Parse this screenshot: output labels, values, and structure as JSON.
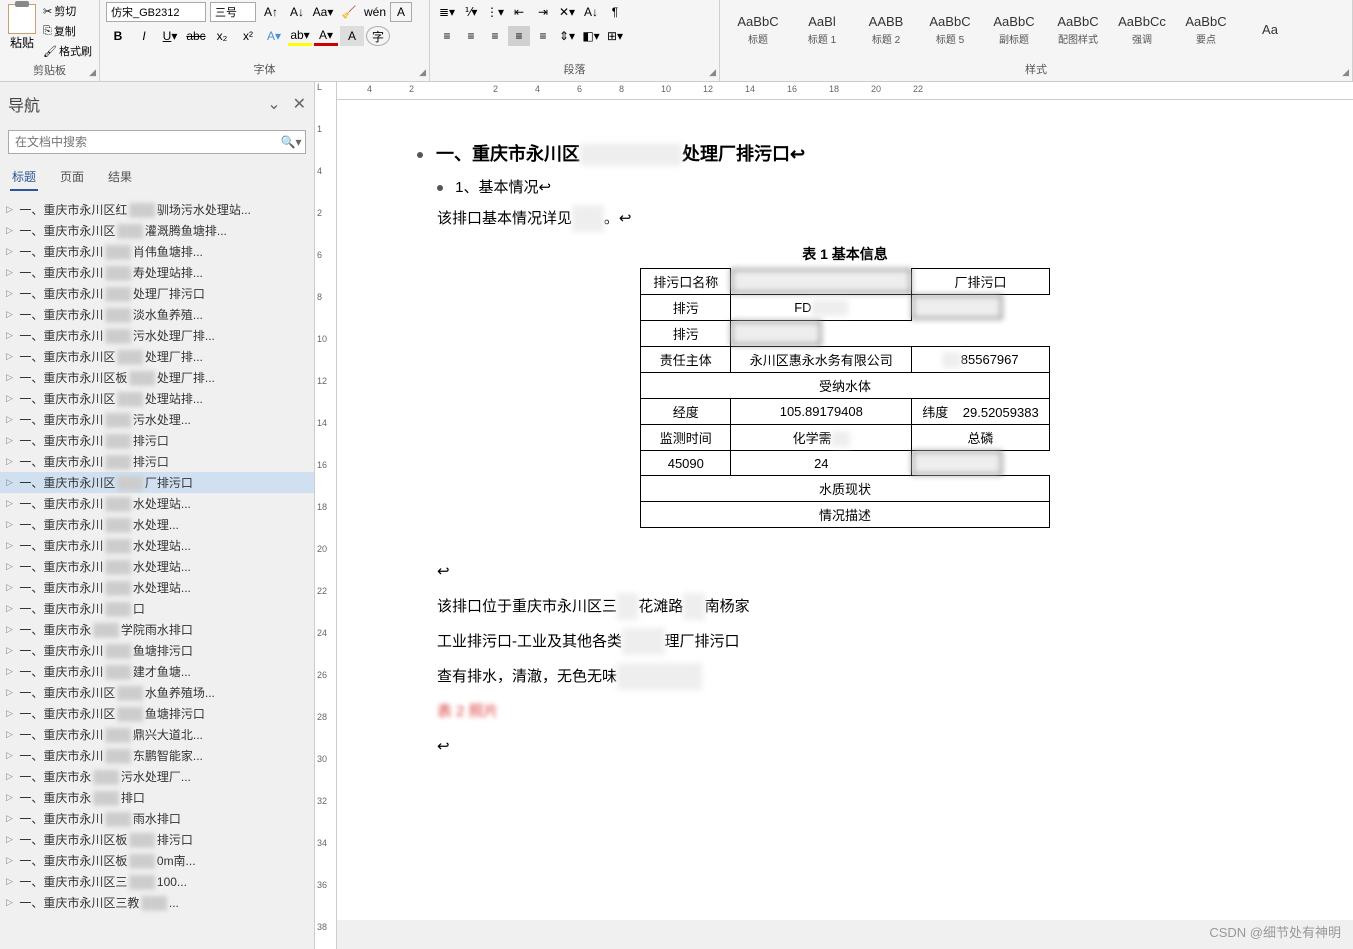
{
  "ribbon": {
    "clipboard": {
      "paste": "粘贴",
      "cut": "剪切",
      "copy": "复制",
      "format_painter": "格式刷",
      "label": "剪贴板"
    },
    "font": {
      "name": "仿宋_GB2312",
      "size": "三号",
      "label": "字体"
    },
    "paragraph": {
      "label": "段落"
    },
    "styles": {
      "label": "样式",
      "items": [
        {
          "preview": "AaBbC",
          "label": "标题"
        },
        {
          "preview": "AaBl",
          "label": "标题 1"
        },
        {
          "preview": "AABB",
          "label": "标题 2"
        },
        {
          "preview": "AaBbC",
          "label": "标题 5"
        },
        {
          "preview": "AaBbC",
          "label": "副标题"
        },
        {
          "preview": "AaBbC",
          "label": "配图样式"
        },
        {
          "preview": "AaBbCc",
          "label": "强调"
        },
        {
          "preview": "AaBbC",
          "label": "要点"
        },
        {
          "preview": "Aa",
          "label": ""
        }
      ]
    }
  },
  "nav": {
    "title": "导航",
    "search_placeholder": "在文档中搜索",
    "tabs": [
      "标题",
      "页面",
      "结果"
    ],
    "items": [
      {
        "pre": "一、",
        "city": "重庆市永川区红",
        "suf": "驯场污水处理站..."
      },
      {
        "pre": "一、",
        "city": "重庆市永川区",
        "suf": "灌溉腾鱼塘排..."
      },
      {
        "pre": "一、",
        "city": "重庆市永川",
        "suf": "肖伟鱼塘排..."
      },
      {
        "pre": "一、",
        "city": "重庆市永川",
        "suf": "寿处理站排..."
      },
      {
        "pre": "一、",
        "city": "重庆市永川",
        "suf": "处理厂排污口"
      },
      {
        "pre": "一、",
        "city": "重庆市永川",
        "suf": "淡水鱼养殖..."
      },
      {
        "pre": "一、",
        "city": "重庆市永川",
        "suf": "污水处理厂排..."
      },
      {
        "pre": "一、",
        "city": "重庆市永川区",
        "suf": "处理厂排..."
      },
      {
        "pre": "一、",
        "city": "重庆市永川区板",
        "suf": "处理厂排..."
      },
      {
        "pre": "一、",
        "city": "重庆市永川区",
        "suf": "处理站排..."
      },
      {
        "pre": "一、",
        "city": "重庆市永川",
        "suf": "污水处理..."
      },
      {
        "pre": "一、",
        "city": "重庆市永川",
        "suf": "排污口"
      },
      {
        "pre": "一、",
        "city": "重庆市永川",
        "suf": "排污口"
      },
      {
        "pre": "一、",
        "city": "重庆市永川区",
        "suf": "厂排污口",
        "selected": true
      },
      {
        "pre": "一、",
        "city": "重庆市永川",
        "suf": "水处理站..."
      },
      {
        "pre": "一、",
        "city": "重庆市永川",
        "suf": "水处理..."
      },
      {
        "pre": "一、",
        "city": "重庆市永川",
        "suf": "水处理站..."
      },
      {
        "pre": "一、",
        "city": "重庆市永川",
        "suf": "水处理站..."
      },
      {
        "pre": "一、",
        "city": "重庆市永川",
        "suf": "水处理站..."
      },
      {
        "pre": "一、",
        "city": "重庆市永川",
        "suf": "口"
      },
      {
        "pre": "一、",
        "city": "重庆市永",
        "suf": "学院雨水排口"
      },
      {
        "pre": "一、",
        "city": "重庆市永川",
        "suf": "鱼塘排污口"
      },
      {
        "pre": "一、",
        "city": "重庆市永川",
        "suf": "建才鱼塘..."
      },
      {
        "pre": "一、",
        "city": "重庆市永川区",
        "suf": "水鱼养殖场..."
      },
      {
        "pre": "一、",
        "city": "重庆市永川区",
        "suf": "鱼塘排污口"
      },
      {
        "pre": "一、",
        "city": "重庆市永川",
        "suf": "鼎兴大道北..."
      },
      {
        "pre": "一、",
        "city": "重庆市永川",
        "suf": "东鹏智能家..."
      },
      {
        "pre": "一、",
        "city": "重庆市永",
        "suf": "污水处理厂..."
      },
      {
        "pre": "一、",
        "city": "重庆市永",
        "suf": "排口"
      },
      {
        "pre": "一、",
        "city": "重庆市永川",
        "suf": "雨水排口"
      },
      {
        "pre": "一、",
        "city": "重庆市永川区板",
        "suf": "排污口"
      },
      {
        "pre": "一、",
        "city": "重庆市永川区板",
        "suf": "0m南..."
      },
      {
        "pre": "一、",
        "city": "重庆市永川区三",
        "suf": "100..."
      },
      {
        "pre": "一、",
        "city": "重庆市永川区三教",
        "suf": "..."
      }
    ]
  },
  "vruler": [
    "L",
    "",
    "1",
    "",
    "4",
    "",
    "2",
    "",
    "6",
    "",
    "8",
    "",
    "10",
    "",
    "12",
    "",
    "14",
    "",
    "16",
    "",
    "18",
    "",
    "20",
    "",
    "22",
    "",
    "24",
    "",
    "26",
    "",
    "28",
    "",
    "30",
    "",
    "32",
    "",
    "34",
    "",
    "36",
    "",
    "38"
  ],
  "hruler": [
    "4",
    "2",
    "",
    "2",
    "4",
    "6",
    "8",
    "10",
    "12",
    "14",
    "16",
    "18",
    "20",
    "22"
  ],
  "doc": {
    "h1_pre": "一、重庆市永川区",
    "h1_suf": "处理厂排污口",
    "h2": "1、基本情况",
    "p1_pre": "该排口基本情况详见",
    "p1_suf": "。",
    "table_caption": "表 1 基本信息",
    "rows": {
      "r1c1": "排污口名称",
      "r1c2": "",
      "r1c3": "厂排污口",
      "r2c1": "排污",
      "r2c2": "",
      "r2c3": "FD",
      "r3c1": "排污",
      "r3c2": "",
      "r4c1": "责任主体",
      "r4c2": "永川区惠永水务有限公司",
      "r4c3": "",
      "r4c4": "85567967",
      "r5c1": "受纳水体",
      "r6c1": "经度",
      "r6c2": "105.89179408",
      "r6c3": "纬度",
      "r6c4": "29.52059383",
      "r7c1": "监测时间",
      "r7c2": "化学需",
      "r7c3": "",
      "r7c4": "总磷",
      "r8c1": "45090",
      "r8c2": "24",
      "r8c3": "",
      "r9c1": "水质现状",
      "r10c1": "情况描述"
    },
    "p2a": "该排口位于重庆市永川区三",
    "p2b": "花滩路",
    "p2c": "南杨家",
    "p3a": "工业排污口-工业及其他各类",
    "p3b": "理厂排污口",
    "p4a": "查有排水，清澈，无色无味",
    "smudge": "表 2   照片"
  },
  "watermark": "CSDN @细节处有神明"
}
